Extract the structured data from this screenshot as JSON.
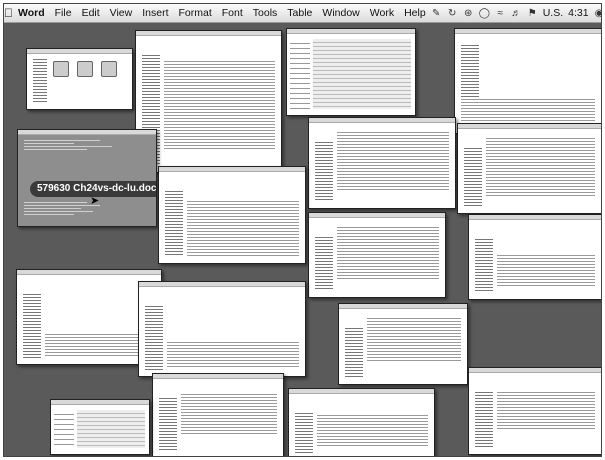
{
  "menubar": {
    "apple_icon": "apple-icon",
    "items": [
      "Word",
      "File",
      "Edit",
      "View",
      "Insert",
      "Format",
      "Font",
      "Tools",
      "Table",
      "Window",
      "Work",
      "Help"
    ],
    "status_icons": [
      "script-icon",
      "sync-icon",
      "bluetooth-icon",
      "airport-icon",
      "wifi-icon",
      "volume-icon"
    ],
    "keyboard_flag": "U.S.",
    "clock": "4:31",
    "spotlight_icon": "spotlight-icon"
  },
  "expose": {
    "selected_window_label": "579630 Ch24vs-dc-lu.doc"
  },
  "colors": {
    "desktop": "#5a5a5a",
    "selected_window": "#8e8e8e"
  }
}
